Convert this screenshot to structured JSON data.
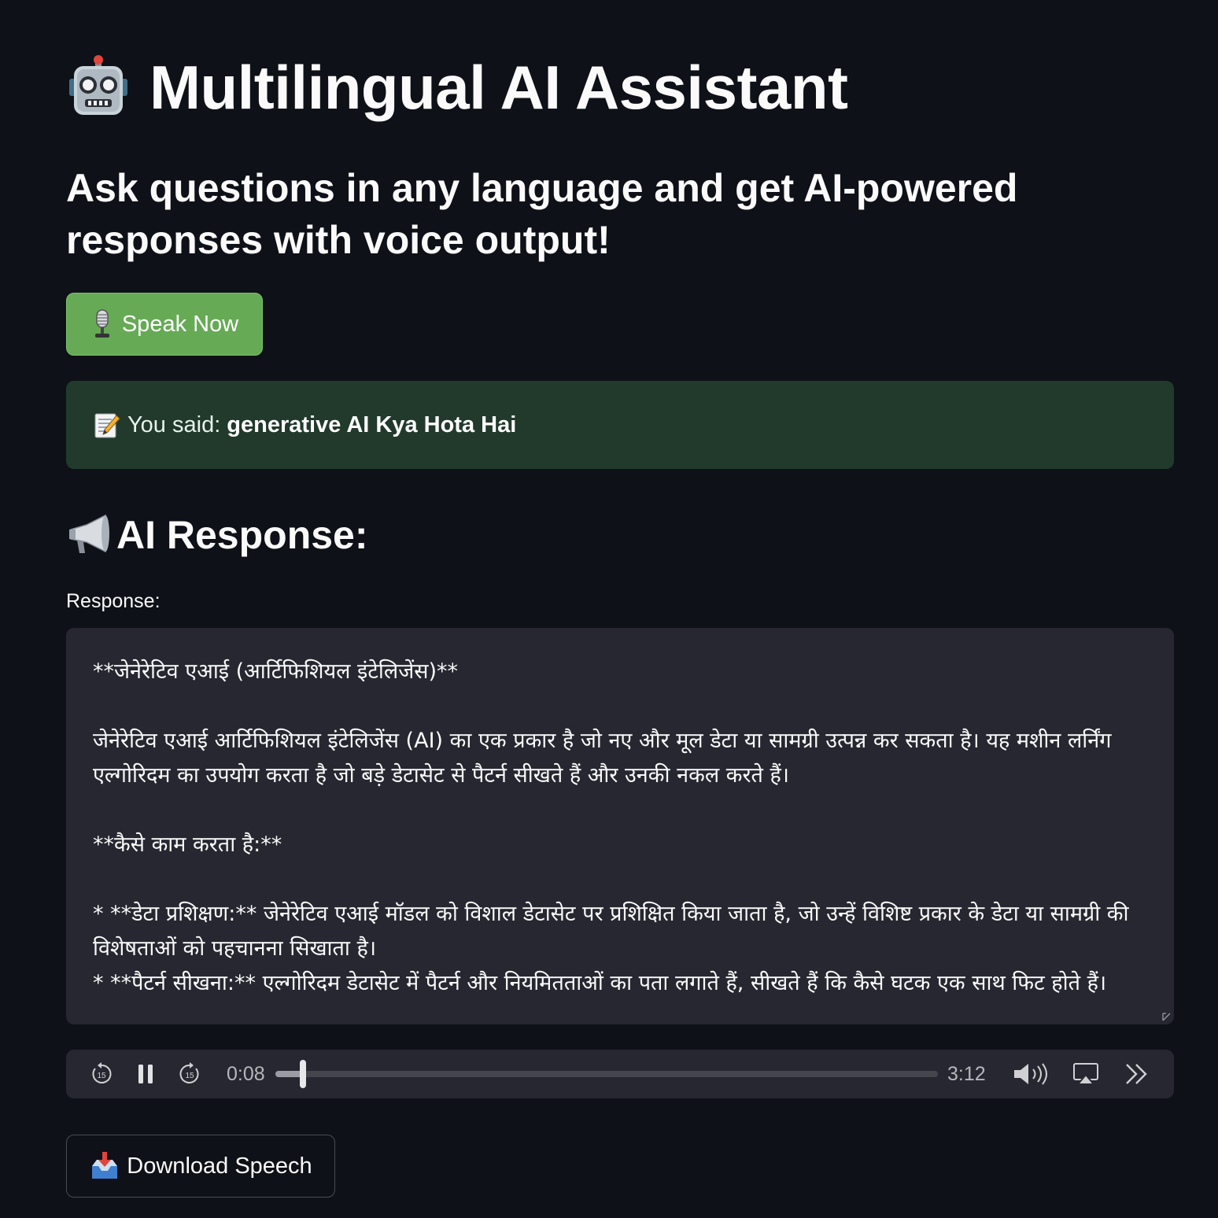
{
  "header": {
    "icon": "robot-icon",
    "title": "Multilingual AI Assistant",
    "subtitle": "Ask questions in any language and get AI-powered responses with voice output!"
  },
  "speak_button": {
    "icon": "microphone-icon",
    "label": "Speak Now",
    "color": "#66aa55"
  },
  "transcript": {
    "icon": "memo-icon",
    "prefix": "You said:",
    "value": "generative AI Kya Hota Hai",
    "background": "#213a2c"
  },
  "response_section": {
    "icon": "megaphone-icon",
    "heading": "AI Response:",
    "field_label": "Response:",
    "text": "**जेनेरेटिव एआई (आर्टिफिशियल इंटेलिजेंस)**\n\nजेनेरेटिव एआई आर्टिफिशियल इंटेलिजेंस (AI) का एक प्रकार है जो नए और मूल डेटा या सामग्री उत्पन्न कर सकता है। यह मशीन लर्निंग एल्गोरिदम का उपयोग करता है जो बड़े डेटासेट से पैटर्न सीखते हैं और उनकी नकल करते हैं।\n\n**कैसे काम करता है:**\n\n* **डेटा प्रशिक्षण:** जेनेरेटिव एआई मॉडल को विशाल डेटासेट पर प्रशिक्षित किया जाता है, जो उन्हें विशिष्ट प्रकार के डेटा या सामग्री की विशेषताओं को पहचानना सिखाता है।\n* **पैटर्न सीखना:** एल्गोरिदम डेटासेट में पैटर्न और नियमितताओं का पता लगाते हैं, सीखते हैं कि कैसे घटक एक साथ फिट होते हैं।"
  },
  "audio_player": {
    "rewind_icon": "rewind-15-icon",
    "pause_icon": "pause-icon",
    "forward_icon": "forward-15-icon",
    "current_time": "0:08",
    "duration": "3:12",
    "progress": 0.042,
    "volume_icon": "volume-icon",
    "airplay_icon": "airplay-icon",
    "speed_icon": "playback-speed-icon"
  },
  "download_button": {
    "icon": "inbox-tray-icon",
    "label": "Download Speech"
  }
}
